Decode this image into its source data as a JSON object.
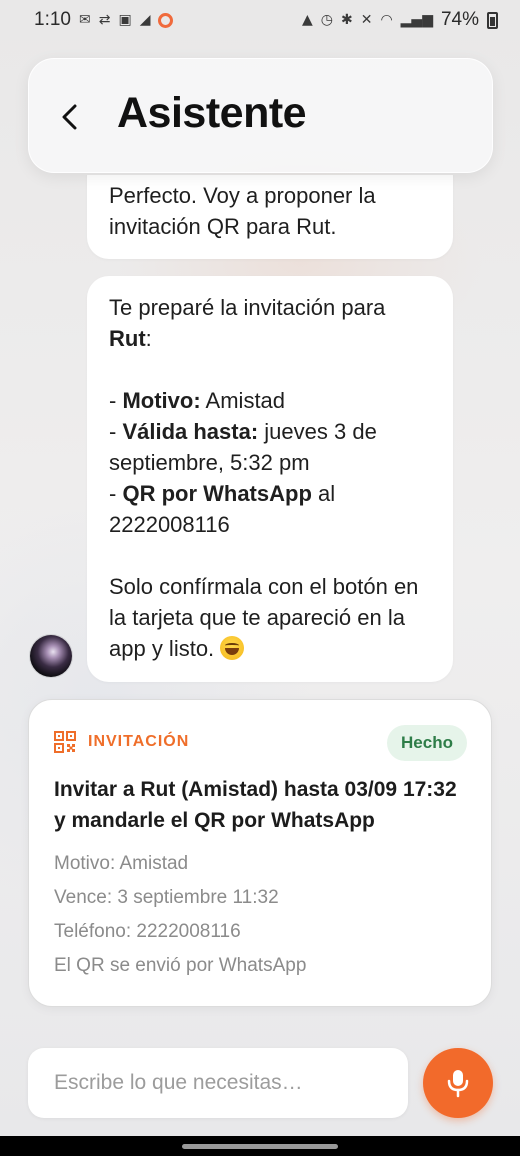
{
  "status_bar": {
    "time": "1:10",
    "battery": "74%"
  },
  "header": {
    "title": "Asistente"
  },
  "messages": {
    "m1_line1": "Perfecto. Voy a proponer la",
    "m1_line2": "invitación QR para Rut.",
    "m2": {
      "intro": "Te preparé la invitación para ",
      "name": "Rut",
      "intro_end": ":",
      "motivo_label": "Motivo:",
      "motivo_value": " Amistad",
      "valida_label": "Válida hasta:",
      "valida_value": " jueves 3 de septiembre, 5:32 pm",
      "qr_label": "QR por WhatsApp",
      "qr_value": " al 2222008116",
      "closing": "Solo confírmala con el botón en la tarjeta que te apareció en la app y listo. "
    }
  },
  "card": {
    "kind": "INVITACIÓN",
    "status": "Hecho",
    "title": "Invitar a Rut (Amistad) hasta 03/09 17:32 y mandarle el QR por WhatsApp",
    "details": {
      "motivo": "Motivo: Amistad",
      "vence": "Vence: 3 septiembre 11:32",
      "telefono": "Teléfono: 2222008116",
      "envio": "El QR se envió por WhatsApp"
    }
  },
  "composer": {
    "placeholder": "Escribe lo que necesitas…"
  },
  "colors": {
    "accent": "#f26a2b",
    "badge_bg": "#e6f4ea",
    "badge_text": "#2e7d48"
  }
}
